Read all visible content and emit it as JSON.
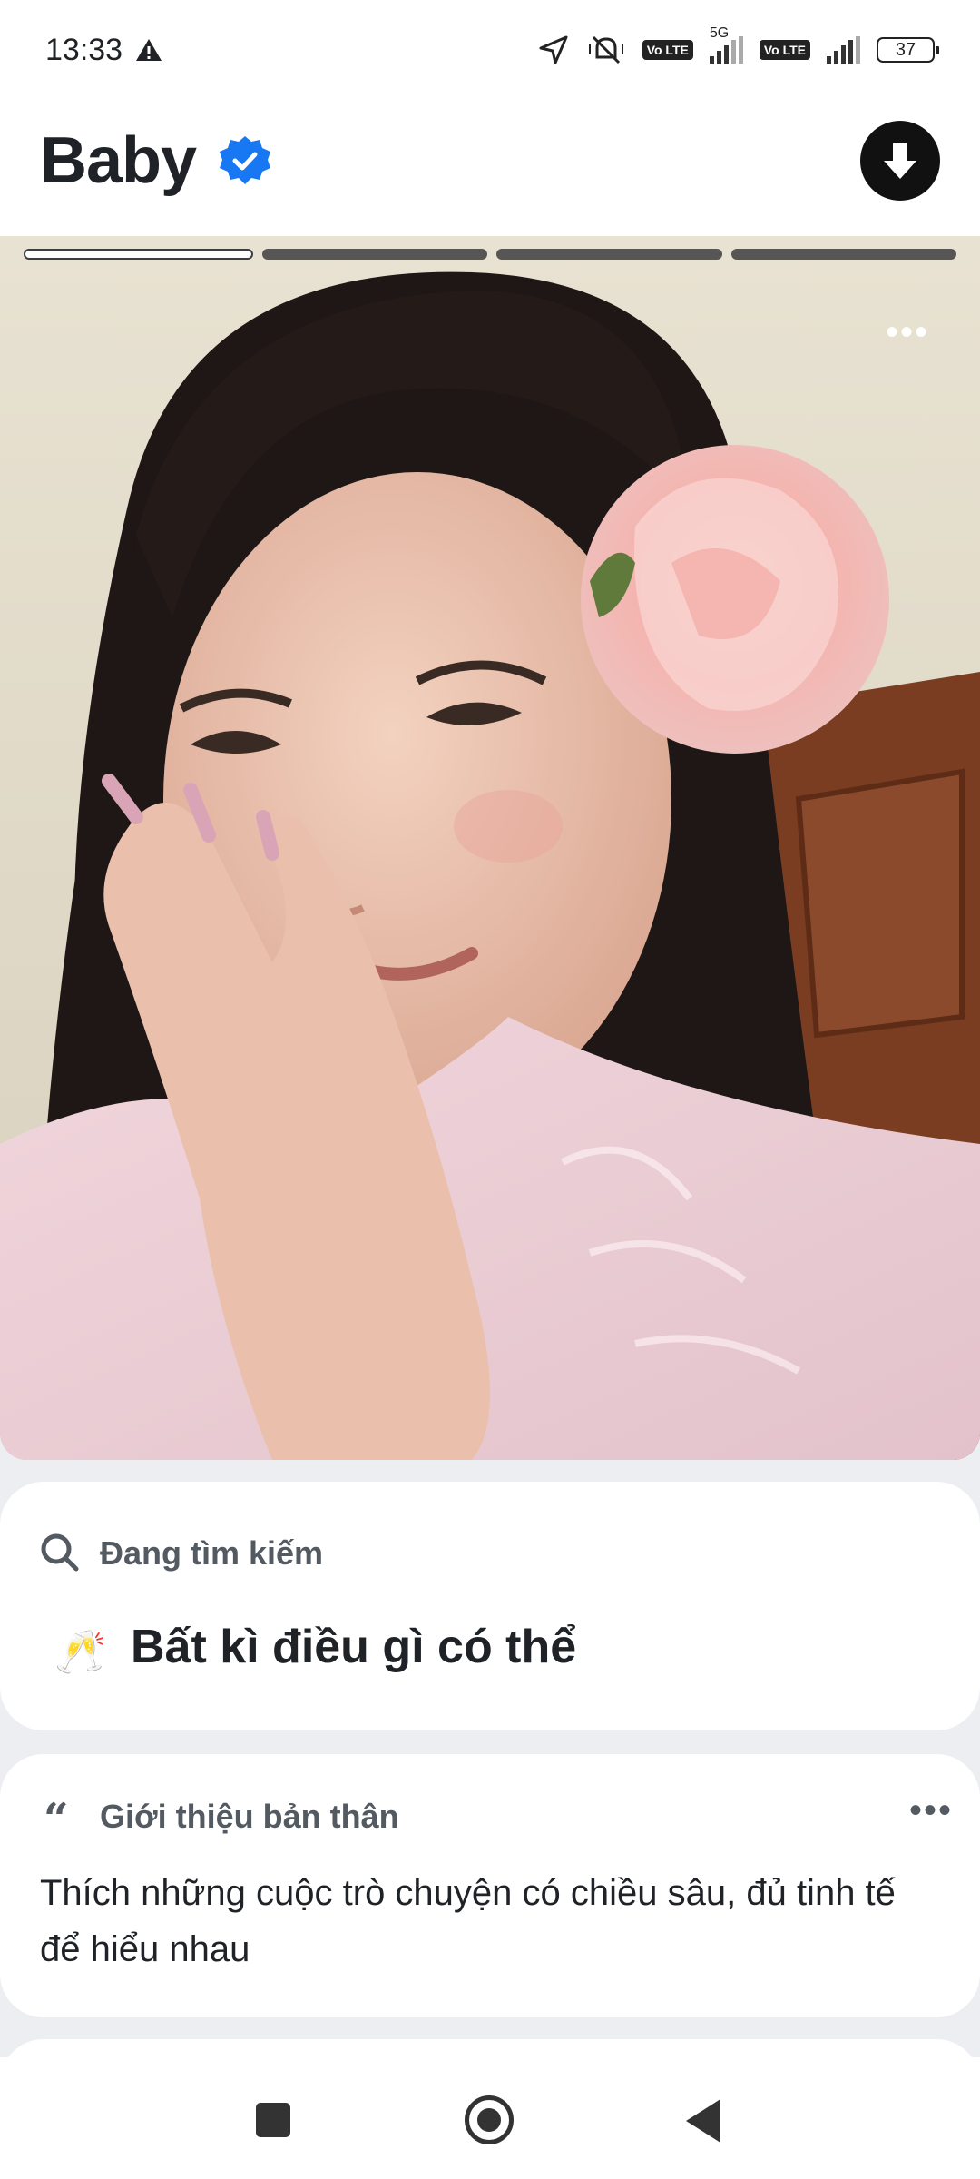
{
  "status_bar": {
    "time": "13:33",
    "network": "5G",
    "volte_1": "Vo LTE",
    "volte_2": "Vo LTE",
    "battery": "37",
    "icons": [
      "warning-icon",
      "location-icon",
      "mute-icon",
      "signal-icon",
      "battery-icon"
    ]
  },
  "header": {
    "name": "Baby",
    "verified": true,
    "accent_color": "#1877f2"
  },
  "photo": {
    "pages": 4,
    "active_page": 1
  },
  "looking_for": {
    "label": "Đang tìm kiếm",
    "emoji": "🥂",
    "value": "Bất kì điều gì có thể"
  },
  "intro": {
    "label": "Giới thiệu bản thân",
    "quote_glyph": "“",
    "text": "Thích những cuộc trò chuyện có chiều sâu, đủ tinh tế để hiểu nhau"
  },
  "nav": {
    "icons": [
      "recents-icon",
      "home-icon",
      "back-icon"
    ]
  }
}
